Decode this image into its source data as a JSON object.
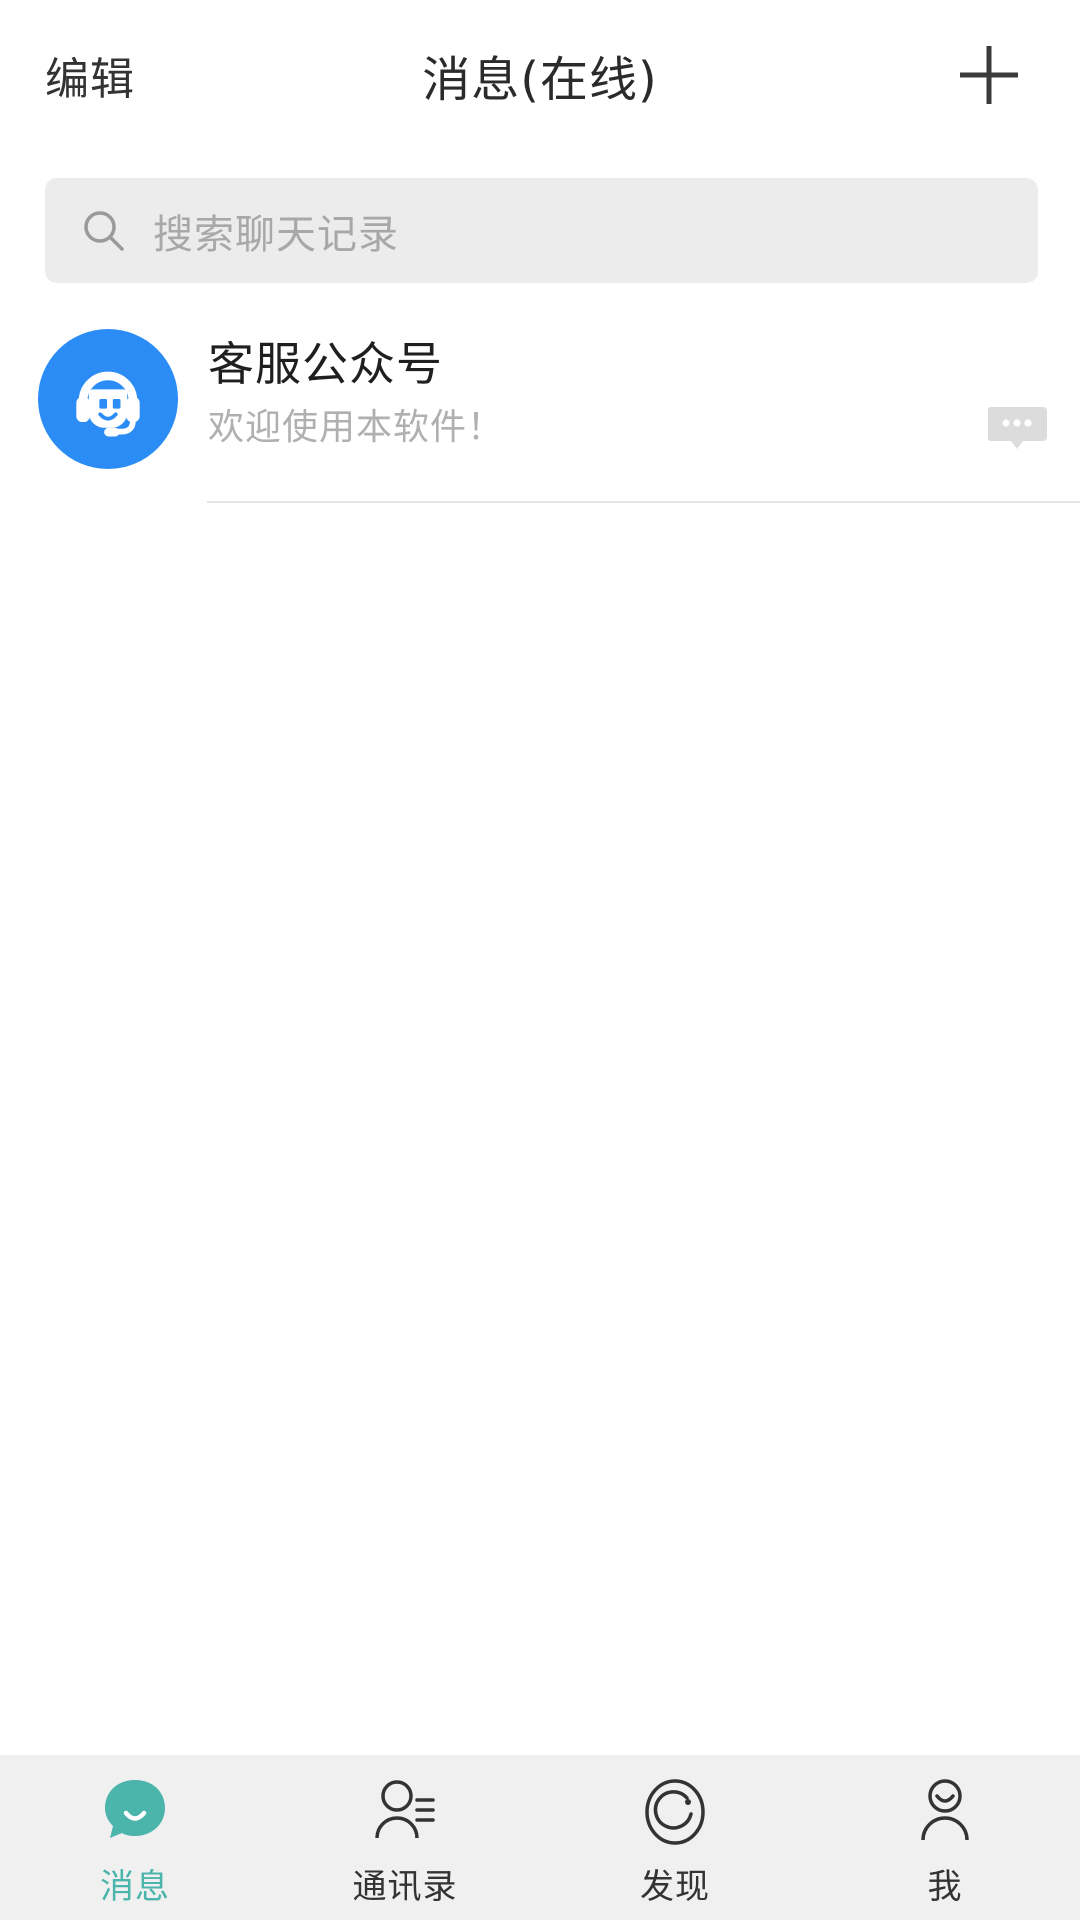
{
  "header": {
    "edit_label": "编辑",
    "title": "消息(在线)",
    "add_icon": "plus-icon"
  },
  "search": {
    "icon": "search-icon",
    "placeholder": "搜索聊天记录",
    "value": ""
  },
  "chats": [
    {
      "avatar_icon": "customer-service-headset-icon",
      "avatar_color": "#2b8cf6",
      "title": "客服公众号",
      "snippet": "欢迎使用本软件！",
      "badge_icon": "message-bubble-dots-icon"
    }
  ],
  "tabbar": {
    "active_color": "#4bb5ab",
    "inactive_color": "#333333",
    "items": [
      {
        "label": "消息",
        "icon": "chat-bubble-icon",
        "active": true
      },
      {
        "label": "通讯录",
        "icon": "contacts-icon",
        "active": false
      },
      {
        "label": "发现",
        "icon": "discover-circle-icon",
        "active": false
      },
      {
        "label": "我",
        "icon": "profile-person-icon",
        "active": false
      }
    ]
  }
}
